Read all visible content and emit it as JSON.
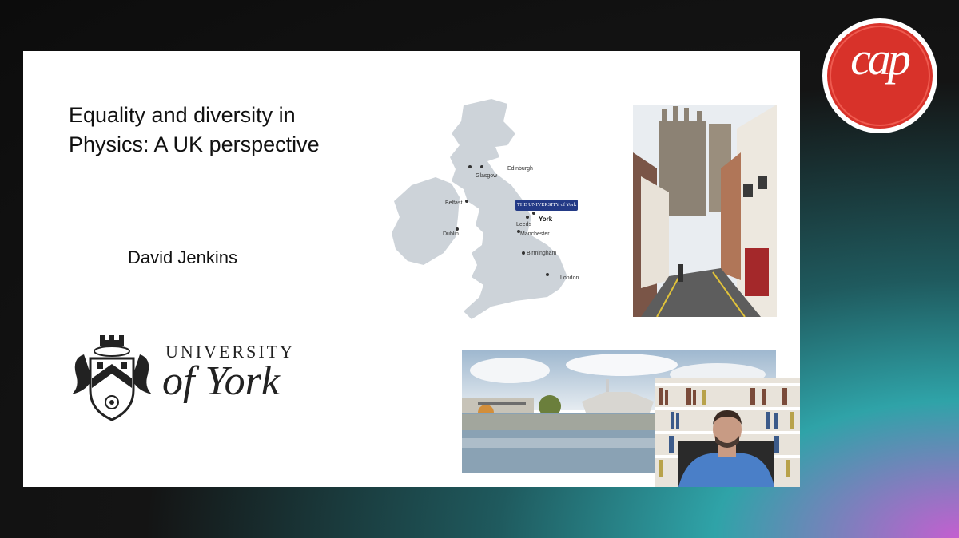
{
  "slide": {
    "title_line1": "Equality and diversity in",
    "title_line2": "Physics: A UK perspective",
    "author": "David Jenkins"
  },
  "university_logo": {
    "line1": "UNIVERSITY",
    "line2": "of York"
  },
  "map": {
    "badge": "THE UNIVERSITY of York",
    "cities": [
      "Edinburgh",
      "Glasgow",
      "Belfast",
      "Dublin",
      "York",
      "Leeds",
      "Manchester",
      "Birmingham",
      "London"
    ]
  },
  "brand": {
    "logo_text": "cap",
    "accent": "#d8322a"
  }
}
